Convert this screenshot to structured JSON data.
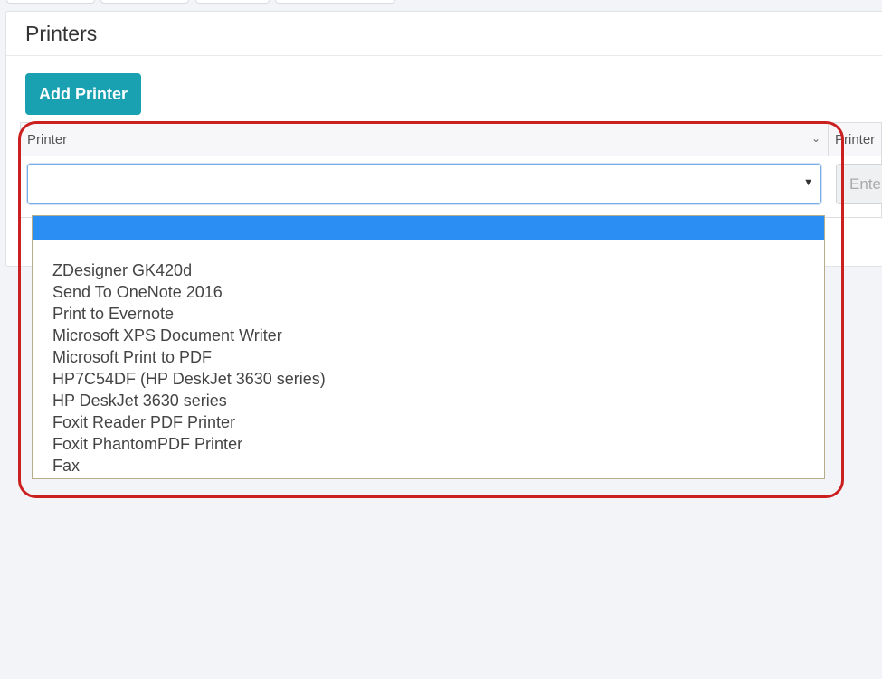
{
  "panel": {
    "title": "Printers"
  },
  "toolbar": {
    "add_label": "Add Printer"
  },
  "table": {
    "columns": [
      "Printer",
      "Printer"
    ],
    "col2_placeholder": "Ente"
  },
  "select": {
    "value": "",
    "options": [
      "",
      "ZDesigner GK420d",
      "Send To OneNote 2016",
      "Print to Evernote",
      "Microsoft XPS Document Writer",
      "Microsoft Print to PDF",
      "HP7C54DF (HP DeskJet 3630 series)",
      "HP DeskJet 3630 series",
      "Foxit Reader PDF Printer",
      "Foxit PhantomPDF Printer",
      "Fax"
    ]
  },
  "icons": {
    "chevron": "chevron-down-icon",
    "caret": "caret-down-icon"
  },
  "colors": {
    "accent": "#1aa1b1",
    "highlight": "#2a8ef2",
    "annotation": "#cc1f1f"
  }
}
